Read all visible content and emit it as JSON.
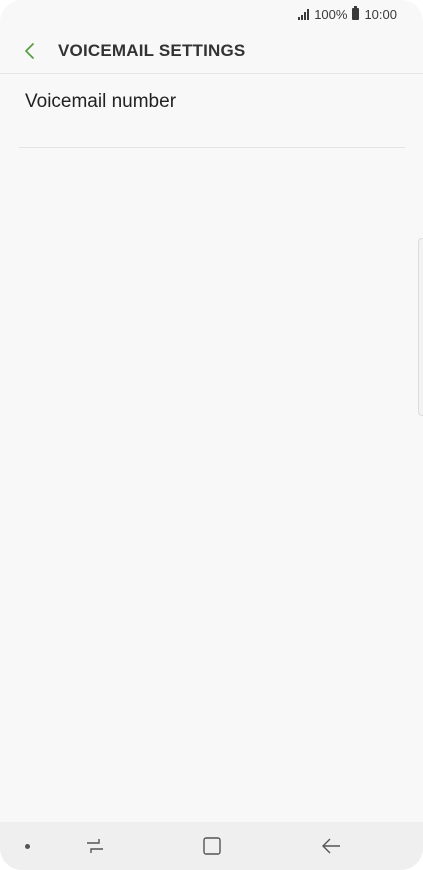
{
  "status_bar": {
    "battery": "100%",
    "time": "10:00"
  },
  "header": {
    "title": "VOICEMAIL SETTINGS",
    "back_icon": "chevron-left-icon",
    "accent_color": "#5a9e47"
  },
  "settings": {
    "items": [
      {
        "label": "Voicemail number"
      }
    ]
  },
  "nav_bar": {
    "icons": [
      "dot-icon",
      "recent-apps-icon",
      "home-icon",
      "back-arrow-icon"
    ]
  }
}
